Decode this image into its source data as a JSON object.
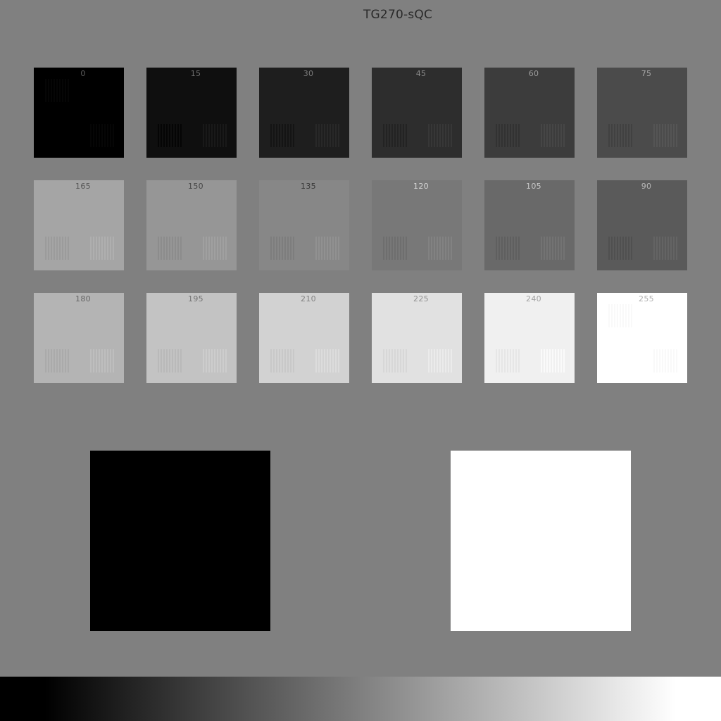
{
  "title": "TG270-sQC",
  "patches": [
    {
      "label": "0",
      "gray": 0
    },
    {
      "label": "15",
      "gray": 15
    },
    {
      "label": "30",
      "gray": 30
    },
    {
      "label": "45",
      "gray": 45
    },
    {
      "label": "60",
      "gray": 60
    },
    {
      "label": "75",
      "gray": 75
    },
    {
      "label": "165",
      "gray": 165
    },
    {
      "label": "150",
      "gray": 150
    },
    {
      "label": "135",
      "gray": 135
    },
    {
      "label": "120",
      "gray": 120
    },
    {
      "label": "105",
      "gray": 105
    },
    {
      "label": "90",
      "gray": 90
    },
    {
      "label": "180",
      "gray": 180
    },
    {
      "label": "195",
      "gray": 195
    },
    {
      "label": "210",
      "gray": 210
    },
    {
      "label": "225",
      "gray": 225
    },
    {
      "label": "240",
      "gray": 240
    },
    {
      "label": "255",
      "gray": 255
    }
  ],
  "fields": {
    "black": "#000000",
    "white": "#ffffff",
    "background": "#808080"
  }
}
